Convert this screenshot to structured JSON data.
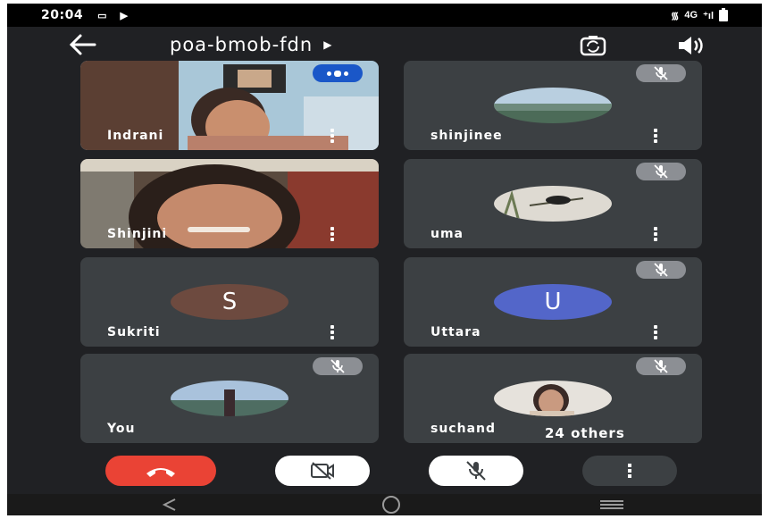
{
  "status_bar": {
    "time": "20:04",
    "network": "4G"
  },
  "header": {
    "meeting_code": "poa-bmob-fdn"
  },
  "participants": [
    {
      "name": "Indrani"
    },
    {
      "name": "shinjinee"
    },
    {
      "name": "Shinjini"
    },
    {
      "name": "uma"
    },
    {
      "name": "Sukriti",
      "initial": "S"
    },
    {
      "name": "Uttara",
      "initial": "U"
    },
    {
      "name": "You"
    },
    {
      "name": "suchand"
    }
  ],
  "others_chip": {
    "label": "24 others"
  },
  "colors": {
    "background": "#202124",
    "tile": "#3c4043",
    "end_call": "#ea4335",
    "sukriti_avatar": "#6d4a3f",
    "uttara_avatar": "#5366c9",
    "speaking_badge": "#1a57c8"
  },
  "icons": [
    "back-arrow-icon",
    "dropdown-caret-icon",
    "switch-camera-icon",
    "speaker-icon",
    "mic-off-icon",
    "more-vert-icon",
    "end-call-icon",
    "camera-off-icon",
    "overflow-menu-icon",
    "nav-back-icon",
    "nav-home-icon",
    "nav-recents-icon"
  ]
}
